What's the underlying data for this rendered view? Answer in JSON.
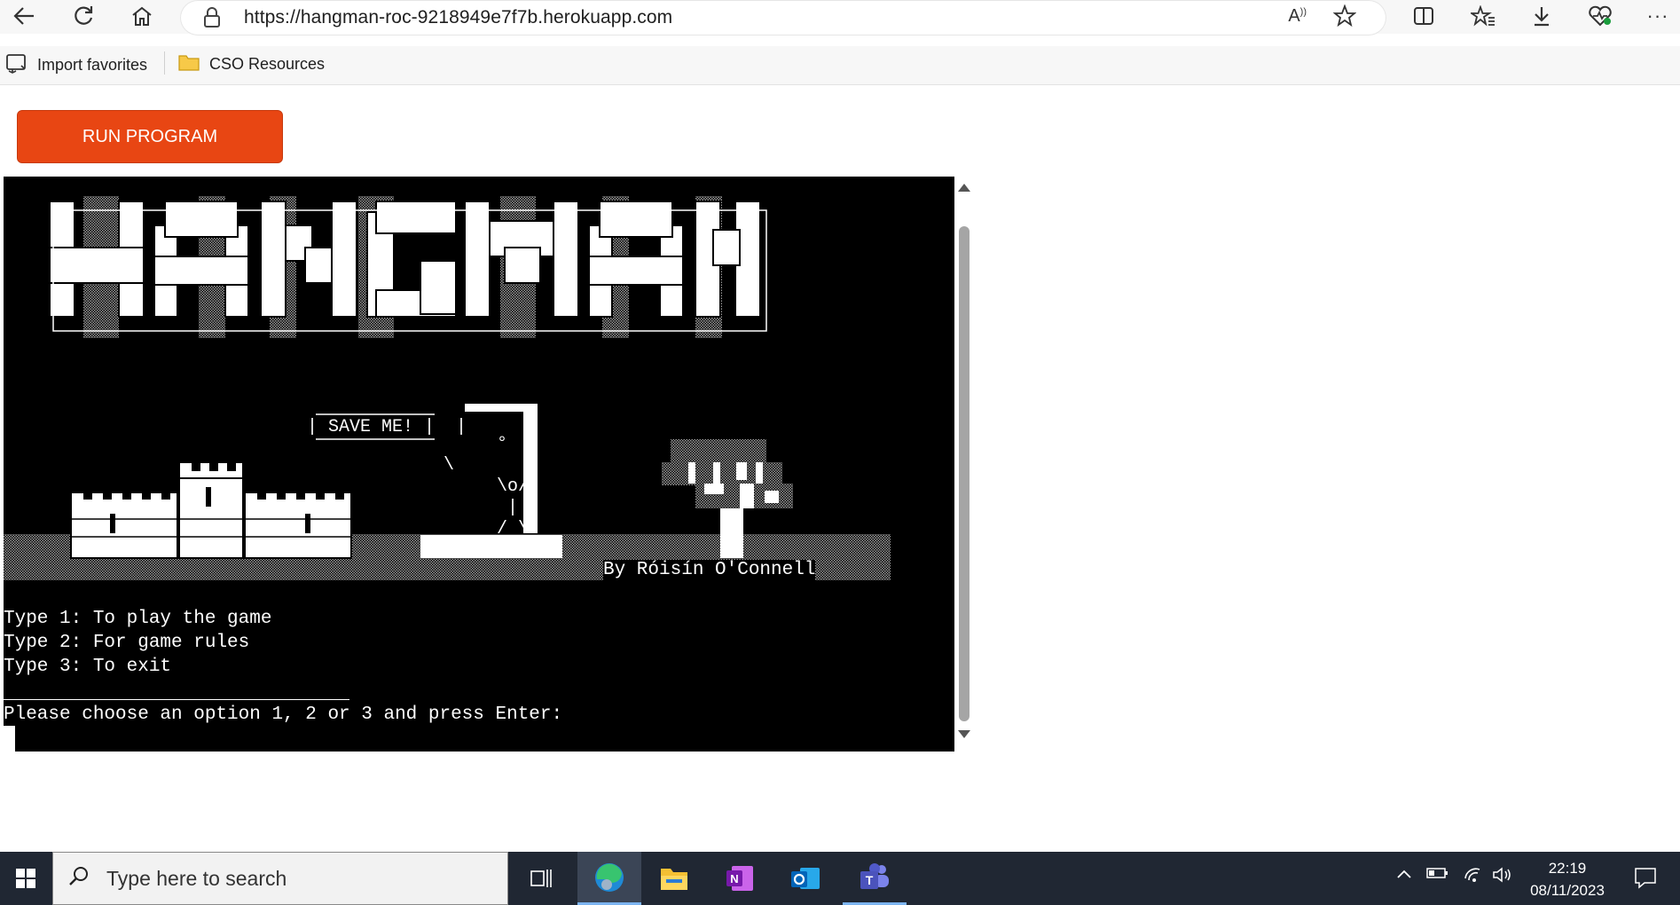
{
  "browser": {
    "url": "https://hangman-roc-9218949e7f7b.herokuapp.com",
    "favorites": [
      {
        "label": "Import favorites",
        "icon": "import-icon"
      },
      {
        "label": "CSO Resources",
        "icon": "folder-icon"
      }
    ]
  },
  "page": {
    "run_button_label": "RUN PROGRAM"
  },
  "terminal": {
    "art_title": "HANGMAN",
    "speech_bubble": "SAVE ME!",
    "byline": "By Róisín O'Connell",
    "menu": [
      "Type 1: To play the game",
      "Type 2: For game rules",
      "Type 3: To exit"
    ],
    "prompt": "Please choose an option 1, 2 or 3 and press Enter:"
  },
  "taskbar": {
    "search_placeholder": "Type here to search",
    "time": "22:19",
    "date": "08/11/2023",
    "apps": [
      "task-view-icon",
      "edge-icon",
      "file-explorer-icon",
      "onenote-icon",
      "outlook-icon",
      "teams-icon"
    ]
  },
  "colors": {
    "run_button": "#e84613",
    "terminal_bg": "#000000",
    "taskbar_bg": "#202733"
  }
}
